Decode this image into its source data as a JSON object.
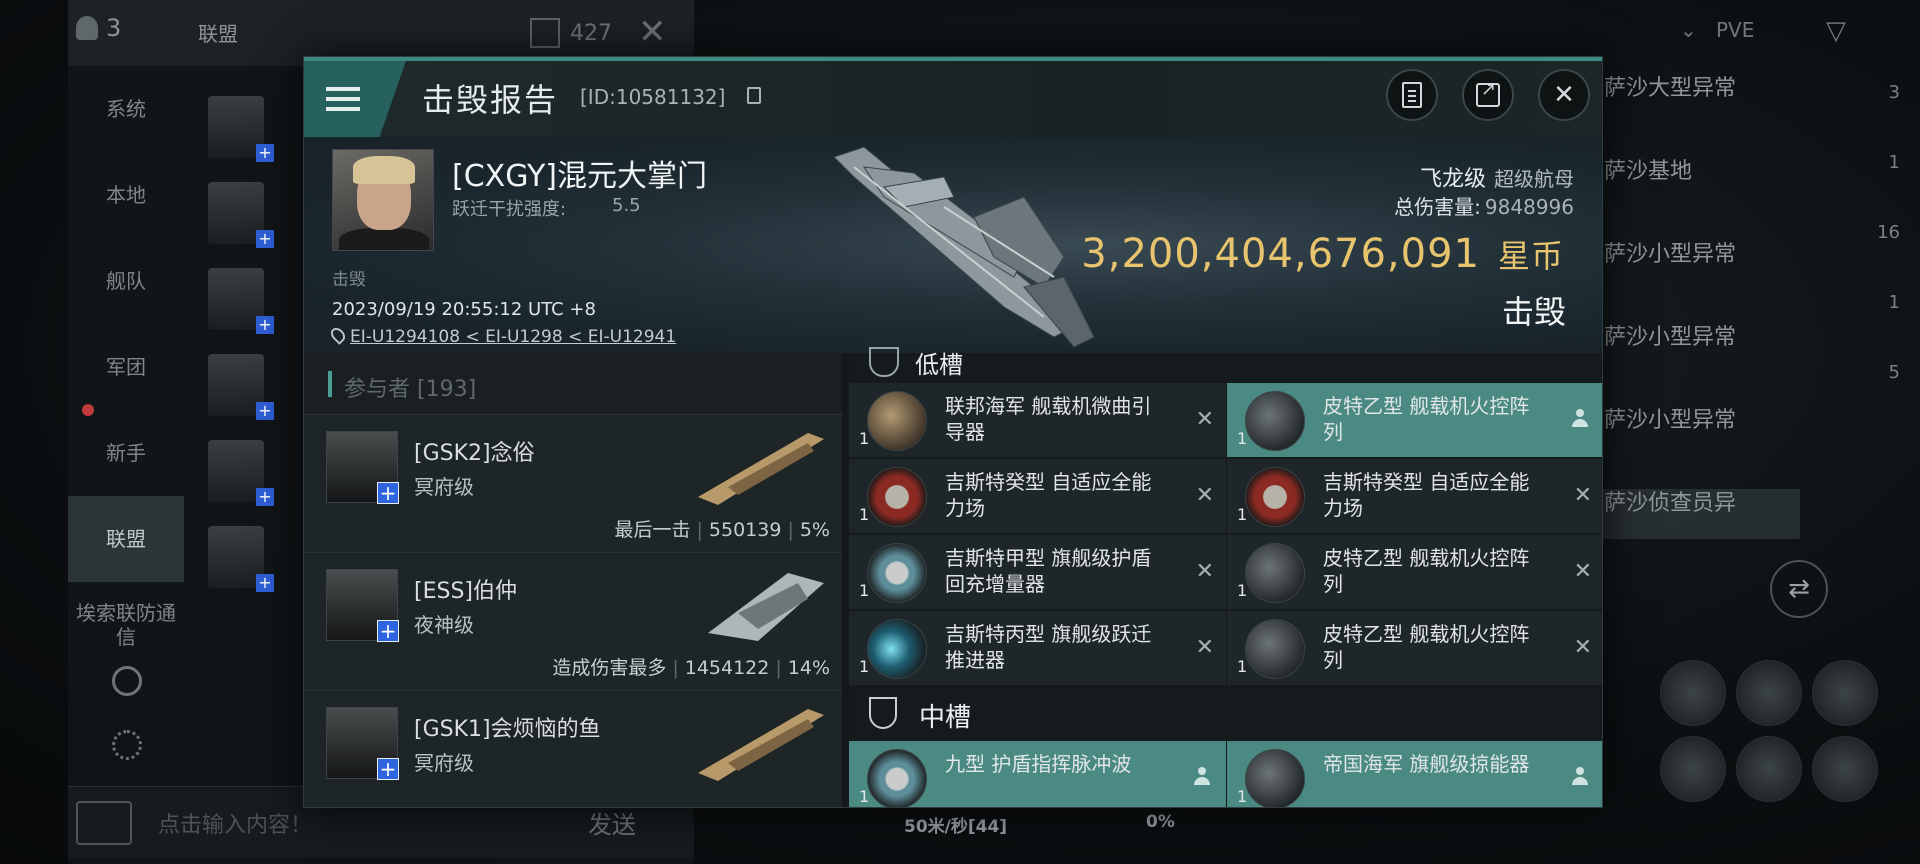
{
  "chat": {
    "member_count": "3",
    "title": "联盟",
    "unread_count": "427",
    "channels": [
      "系统",
      "本地",
      "舰队",
      "军团",
      "新手",
      "联盟",
      "埃索联防通信"
    ],
    "input_placeholder": "点击输入内容！",
    "send_label": "发送"
  },
  "overview": {
    "filter": "PVE",
    "rows": [
      "萨沙大型异常",
      "萨沙基地",
      "萨沙小型异常",
      "萨沙小型异常",
      "萨沙小型异常",
      "萨沙侦查员异"
    ],
    "side_counts": [
      "3",
      "1",
      "16",
      "1",
      "5"
    ]
  },
  "hud": {
    "speed": "50米/秒[44]",
    "percent": "0%"
  },
  "report": {
    "title": "击毁报告",
    "id": "[ID:10581132]",
    "victim": {
      "name": "[CXGY]混元大掌门",
      "warp_label": "跃迁干扰强度:",
      "warp_value": "5.5",
      "tag": "击毁",
      "datetime": "2023/09/19 20:55:12 UTC +8",
      "location": "EI-U1294108 < EI-U1298 < EI-U12941"
    },
    "ship": {
      "name": "飞龙级",
      "class": "超级航母",
      "total_damage_label": "总伤害量:",
      "total_damage": "9848996",
      "value": "3,200,404,676,091",
      "currency": "星币",
      "status": "击毁"
    },
    "participants": {
      "header": "参与者 [193]",
      "items": [
        {
          "name": "[GSK2]念俗",
          "ship": "冥府级",
          "role": "最后一击",
          "damage": "550139",
          "pct": "5%"
        },
        {
          "name": "[ESS]伯仲",
          "ship": "夜神级",
          "role": "造成伤害最多",
          "damage": "1454122",
          "pct": "14%"
        },
        {
          "name": "[GSK1]会烦恼的鱼",
          "ship": "冥府级",
          "role": "",
          "damage": "",
          "pct": ""
        }
      ]
    },
    "low_slot_label": "低槽",
    "low_slots": [
      {
        "name": "联邦海军 舰载机微曲引导器",
        "qty": "1",
        "state": "destroyed",
        "icon": "gold"
      },
      {
        "name": "皮特乙型 舰载机火控阵列",
        "qty": "1",
        "state": "dropped",
        "icon": "gray"
      },
      {
        "name": "吉斯特癸型 自适应全能力场",
        "qty": "1",
        "state": "destroyed",
        "icon": "red"
      },
      {
        "name": "吉斯特癸型 自适应全能力场",
        "qty": "1",
        "state": "destroyed",
        "icon": "red"
      },
      {
        "name": "吉斯特甲型 旗舰级护盾回充增量器",
        "qty": "1",
        "state": "destroyed",
        "icon": "shield"
      },
      {
        "name": "皮特乙型 舰载机火控阵列",
        "qty": "1",
        "state": "destroyed",
        "icon": "gray"
      },
      {
        "name": "吉斯特丙型 旗舰级跃迁推进器",
        "qty": "1",
        "state": "destroyed",
        "icon": "blue"
      },
      {
        "name": "皮特乙型 舰载机火控阵列",
        "qty": "1",
        "state": "destroyed",
        "icon": "gray"
      }
    ],
    "mid_slot_label": "中槽",
    "mid_slots": [
      {
        "name": "九型 护盾指挥脉冲波",
        "qty": "1",
        "state": "dropped",
        "icon": "shield"
      },
      {
        "name": "帝国海军 旗舰级掠能器",
        "qty": "1",
        "state": "dropped",
        "icon": "gray"
      }
    ]
  }
}
